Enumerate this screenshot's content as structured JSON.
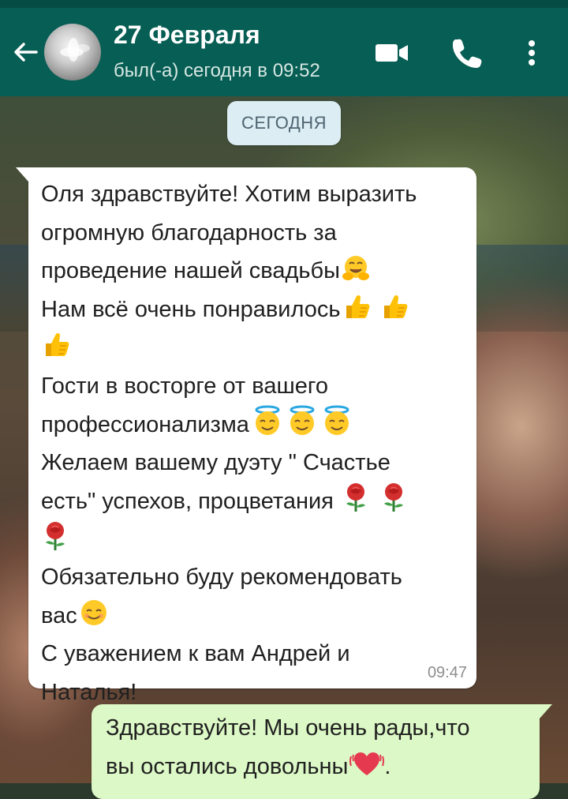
{
  "header": {
    "title": "27 Февраля",
    "status": "был(-а) сегодня в 09:52",
    "icons": [
      "back-arrow-icon",
      "video-call-icon",
      "phone-icon",
      "more-vert-icon"
    ],
    "color": "#075e54"
  },
  "date_divider": "СЕГОДНЯ",
  "incoming": {
    "lines": [
      "Оля здравствуйте! Хотим выразить",
      "огромную благодарность за",
      "проведение нашей свадьбы",
      "Нам всё очень понравилось",
      "",
      "Гости в восторге от вашего",
      "профессионализма",
      "Желаем вашему дуэту \" Счастье",
      "есть\" успехов, процветания ",
      "",
      "Обязательно буду рекомендовать",
      "вас",
      "С уважением к вам Андрей и",
      "Наталья!"
    ],
    "emojis": [
      "hugging-face-emoji",
      "thumbs-up-emoji",
      "smiling-face-with-halo-emoji",
      "rose-emoji",
      "smiling-face-emoji"
    ],
    "time": "09:47"
  },
  "outgoing": {
    "lines": [
      "Здравствуйте! Мы очень рады,что",
      "вы остались довольны",
      "."
    ],
    "emojis": [
      "beating-heart-emoji"
    ]
  }
}
